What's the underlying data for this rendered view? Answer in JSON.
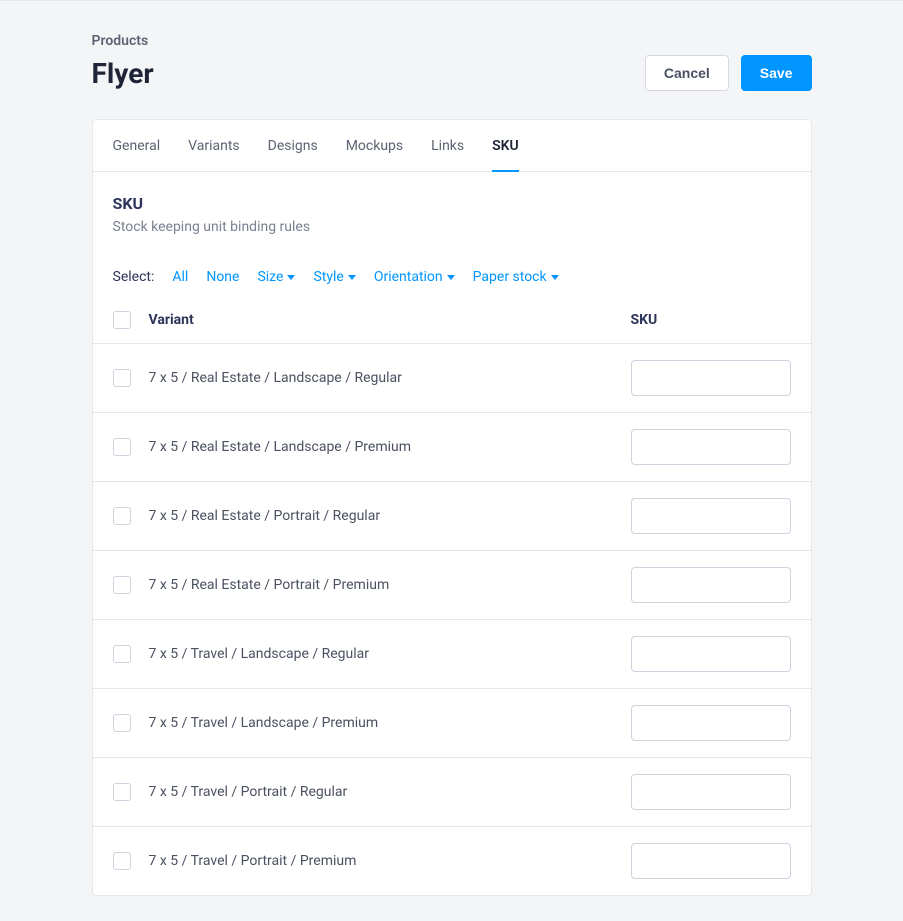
{
  "breadcrumb": "Products",
  "title": "Flyer",
  "buttons": {
    "cancel": "Cancel",
    "save": "Save"
  },
  "tabs": [
    {
      "label": "General",
      "active": false
    },
    {
      "label": "Variants",
      "active": false
    },
    {
      "label": "Designs",
      "active": false
    },
    {
      "label": "Mockups",
      "active": false
    },
    {
      "label": "Links",
      "active": false
    },
    {
      "label": "SKU",
      "active": true
    }
  ],
  "panel": {
    "title": "SKU",
    "subtitle": "Stock keeping unit binding rules"
  },
  "filters": {
    "label": "Select:",
    "items": [
      {
        "text": "All",
        "caret": false
      },
      {
        "text": "None",
        "caret": false
      },
      {
        "text": "Size",
        "caret": true
      },
      {
        "text": "Style",
        "caret": true
      },
      {
        "text": "Orientation",
        "caret": true
      },
      {
        "text": "Paper stock",
        "caret": true
      }
    ]
  },
  "headers": {
    "variant": "Variant",
    "sku": "SKU"
  },
  "rows": [
    {
      "variant": "7 x 5 / Real Estate / Landscape / Regular",
      "sku": ""
    },
    {
      "variant": "7 x 5 / Real Estate / Landscape / Premium",
      "sku": ""
    },
    {
      "variant": "7 x 5 / Real Estate / Portrait / Regular",
      "sku": ""
    },
    {
      "variant": "7 x 5 / Real Estate / Portrait / Premium",
      "sku": ""
    },
    {
      "variant": "7 x 5 / Travel / Landscape / Regular",
      "sku": ""
    },
    {
      "variant": "7 x 5 / Travel / Landscape / Premium",
      "sku": ""
    },
    {
      "variant": "7 x 5 / Travel / Portrait / Regular",
      "sku": ""
    },
    {
      "variant": "7 x 5 / Travel / Portrait / Premium",
      "sku": ""
    }
  ]
}
